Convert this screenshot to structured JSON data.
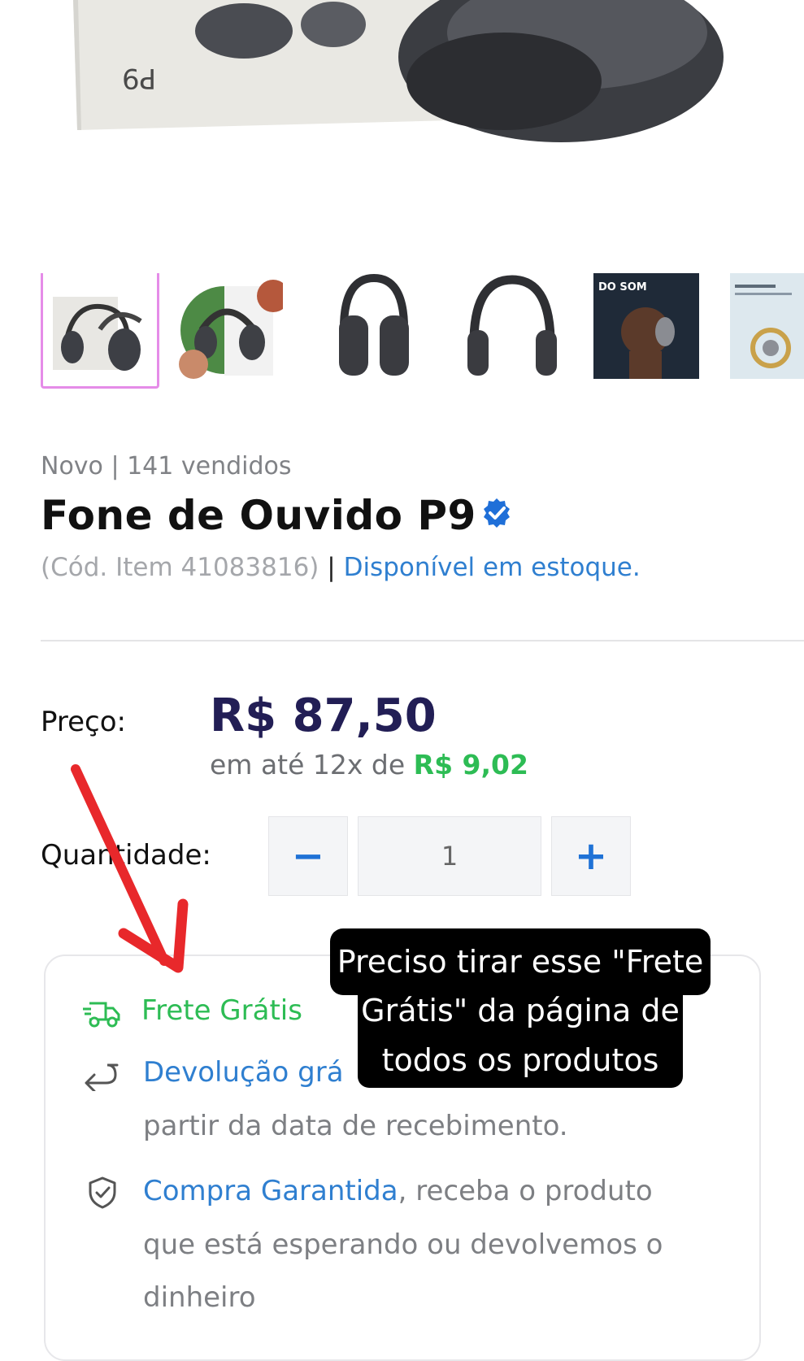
{
  "product": {
    "meta": "Novo | 141 vendidos",
    "title": "Fone de Ouvido P9",
    "code": "(Cód. Item 41083816)",
    "separator": "|",
    "stock": "Disponível em estoque.",
    "box_label": "P9"
  },
  "thumbnails": [
    {
      "alt": "headphones-box"
    },
    {
      "alt": "headphones-lifestyle"
    },
    {
      "alt": "headphones-front"
    },
    {
      "alt": "headphones-side"
    },
    {
      "alt": "headphones-model",
      "caption": "DO SOM"
    },
    {
      "alt": "headphones-detail"
    }
  ],
  "pricing": {
    "label": "Preço:",
    "price": "R$ 87,50",
    "installments_prefix": "em até 12x de",
    "installments_value": "R$ 9,02"
  },
  "quantity": {
    "label": "Quantidade:",
    "value": "1",
    "minus": "−",
    "plus": "+"
  },
  "benefits": {
    "shipping": "Frete Grátis",
    "returns_link": "Devolução grá",
    "returns_rest": "partir da data de recebimento.",
    "guarantee_link": "Compra Garantida",
    "guarantee_rest_1": ", receba o produto",
    "guarantee_rest_2": "que está esperando ou devolvemos o",
    "guarantee_rest_3": "dinheiro"
  },
  "annotation": {
    "line1": "Preciso tirar esse \"Frete",
    "line2": "Grátis\" da página de",
    "line3": "todos os produtos"
  },
  "colors": {
    "accent_blue": "#2f7fd0",
    "price_navy": "#221e55",
    "green": "#2dbc54",
    "selected_thumb_border": "#e58ce8",
    "annotation_arrow": "#e8282b"
  }
}
